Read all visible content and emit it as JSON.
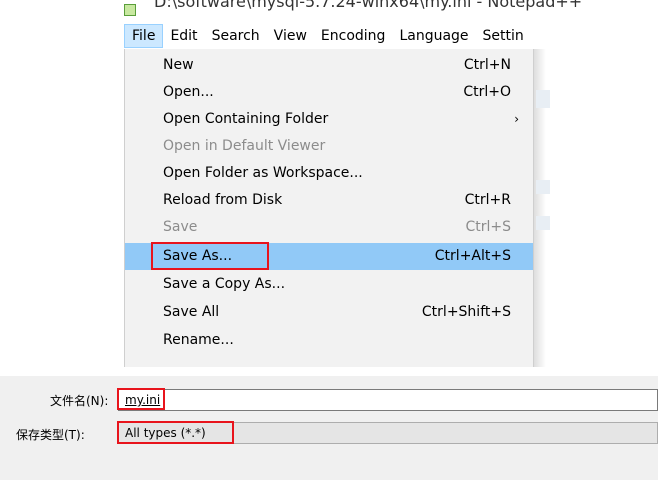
{
  "window": {
    "title": "D:\\software\\mysql-5.7.24-winx64\\my.ini - Notepad++"
  },
  "menubar": {
    "items": [
      "File",
      "Edit",
      "Search",
      "View",
      "Encoding",
      "Language",
      "Settin"
    ]
  },
  "file_menu": {
    "items": [
      {
        "label": "New",
        "shortcut": "Ctrl+N",
        "state": "enabled"
      },
      {
        "label": "Open...",
        "shortcut": "Ctrl+O",
        "state": "enabled"
      },
      {
        "label": "Open Containing Folder",
        "shortcut": "",
        "submenu": true,
        "state": "enabled"
      },
      {
        "label": "Open in Default Viewer",
        "shortcut": "",
        "state": "disabled"
      },
      {
        "label": "Open Folder as Workspace...",
        "shortcut": "",
        "state": "enabled"
      },
      {
        "label": "Reload from Disk",
        "shortcut": "Ctrl+R",
        "state": "enabled"
      },
      {
        "label": "Save",
        "shortcut": "Ctrl+S",
        "state": "disabled"
      },
      {
        "label": "Save As...",
        "shortcut": "Ctrl+Alt+S",
        "state": "highlighted"
      },
      {
        "label": "Save a Copy As...",
        "shortcut": "",
        "state": "enabled"
      },
      {
        "label": "Save All",
        "shortcut": "Ctrl+Shift+S",
        "state": "enabled"
      },
      {
        "label": "Rename...",
        "shortcut": "",
        "state": "enabled"
      }
    ],
    "submenu_arrow": "›"
  },
  "save_dialog": {
    "filename_label": "文件名(N):",
    "filename_value": "my.ini",
    "filetype_label": "保存类型(T):",
    "filetype_value": "All types (*.*)"
  },
  "colors": {
    "highlight": "#91c9f7",
    "annotation_box": "#e8141c",
    "menu_bg": "#f2f2f2",
    "disabled_text": "#8c8c8c"
  }
}
